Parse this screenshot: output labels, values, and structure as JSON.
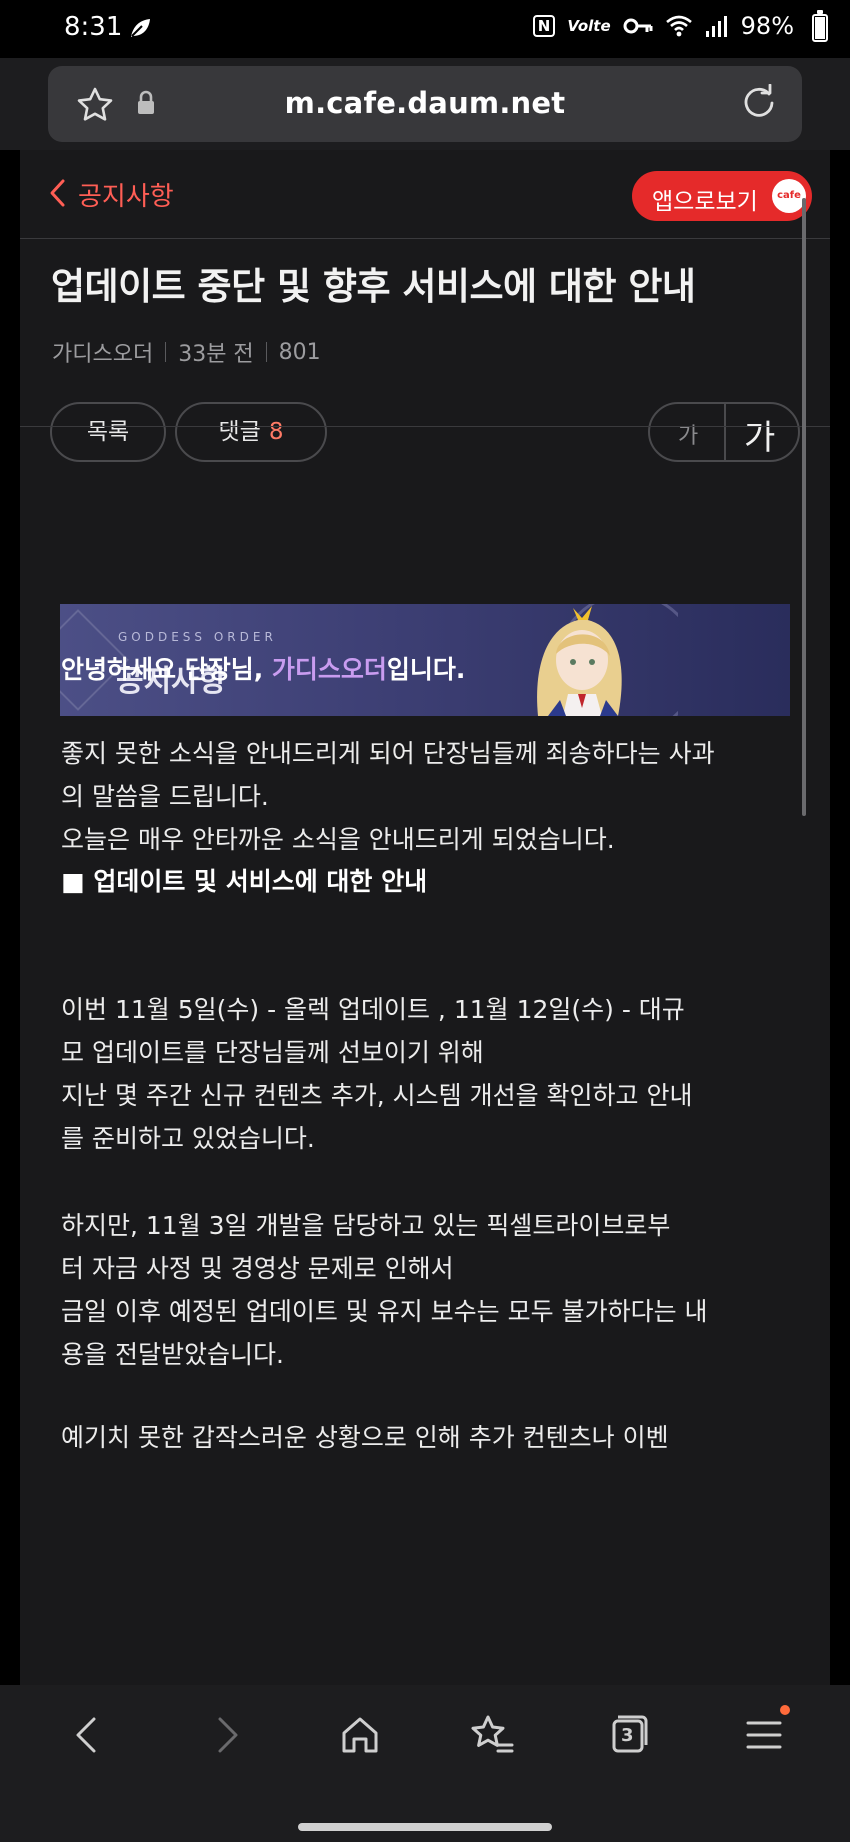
{
  "status_bar": {
    "time": "8:31",
    "nfc": "N",
    "volte": "Volte",
    "battery": "98%",
    "battery_level": 0.98,
    "icons": [
      "leaf-icon",
      "nfc-icon",
      "volte-icon",
      "key-icon",
      "wifi-icon",
      "signal-icon",
      "battery-icon"
    ]
  },
  "browser": {
    "url": "m.cafe.daum.net",
    "icons": [
      "star-icon",
      "lock-icon",
      "reload-icon"
    ]
  },
  "header": {
    "board_name": "공지사항",
    "app_view_label": "앱으로보기",
    "cafe_badge": "cafe"
  },
  "post": {
    "title": "업데이트 중단 및 향후 서비스에 대한 안내",
    "author": "가디스오더",
    "time_ago": "33분 전",
    "views": "801",
    "list_button": "목록",
    "comment_label": "댓글",
    "comment_count": "8",
    "font_small": "가",
    "font_large": "가"
  },
  "banner": {
    "subtitle": "GODDESS ORDER",
    "title": "공지사항"
  },
  "content": {
    "greeting_pre": "안녕하세요 단장님, ",
    "greeting_name": "가디스오더",
    "greeting_post": "입니다.",
    "p1_l1": "좋지 못한 소식을 안내드리게 되어 단장님들께 죄송하다는 사과",
    "p1_l2": "의 말씀을 드립니다.",
    "p1_l3": "오늘은 매우 안타까운 소식을 안내드리게 되었습니다.",
    "section_heading": "■ 업데이트 및 서비스에 대한 안내",
    "p2_l1": "이번 11월 5일(수) - 올렉 업데이트 , 11월 12일(수) - 대규",
    "p2_l2": "모 업데이트를 단장님들께 선보이기 위해",
    "p2_l3": "지난 몇 주간 신규 컨텐츠 추가, 시스템 개선을 확인하고 안내",
    "p2_l4": "를 준비하고 있었습니다.",
    "p3_l1": "하지만, 11월 3일 개발을 담당하고 있는 픽셀트라이브로부",
    "p3_l2": "터 자금 사정 및 경영상 문제로 인해서",
    "p3_l3": "금일 이후 예정된 업데이트 및 유지 보수는 모두 불가하다는 내",
    "p3_l4": "용을 전달받았습니다.",
    "p4_l1": "예기치 못한 갑작스러운 상황으로 인해 추가 컨텐츠나 이벤"
  },
  "bottom_nav": {
    "tabs_count": "3",
    "icons": [
      "back-icon",
      "forward-icon",
      "home-icon",
      "bookmarks-icon",
      "tabs-icon",
      "menu-icon"
    ]
  }
}
